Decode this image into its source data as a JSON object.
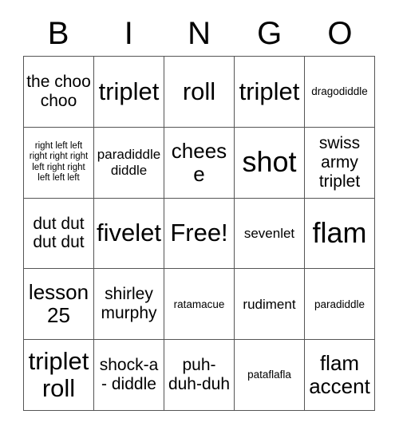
{
  "header": {
    "letters": [
      "B",
      "I",
      "N",
      "G",
      "O"
    ]
  },
  "colors": {
    "background": "#ffffff",
    "text": "#000000",
    "grid_line": "#555555"
  },
  "grid": {
    "columns": 5,
    "rows": 5,
    "free_space_label": "Free!",
    "cells": [
      {
        "text": "the choo choo",
        "size": "lg"
      },
      {
        "text": "triplet",
        "size": "xxl"
      },
      {
        "text": "roll",
        "size": "xxl"
      },
      {
        "text": "triplet",
        "size": "xxl"
      },
      {
        "text": "dragodiddle",
        "size": "sm"
      },
      {
        "text": "right left left right right right left right right left left left",
        "size": "xs"
      },
      {
        "text": "paradiddle diddle",
        "size": "md"
      },
      {
        "text": "cheese",
        "size": "xl"
      },
      {
        "text": "shot",
        "size": "huge"
      },
      {
        "text": "swiss army triplet",
        "size": "lg"
      },
      {
        "text": "dut dut dut dut",
        "size": "lg"
      },
      {
        "text": "fivelet",
        "size": "xxl"
      },
      {
        "text": "Free!",
        "size": "xxl"
      },
      {
        "text": "sevenlet",
        "size": "md"
      },
      {
        "text": "flam",
        "size": "huge"
      },
      {
        "text": "lesson 25",
        "size": "xl"
      },
      {
        "text": "shirley murphy",
        "size": "lg"
      },
      {
        "text": "ratamacue",
        "size": "sm"
      },
      {
        "text": "rudiment",
        "size": "md"
      },
      {
        "text": "paradiddle",
        "size": "sm"
      },
      {
        "text": "triplet roll",
        "size": "xxl"
      },
      {
        "text": "shock-a - diddle",
        "size": "lg"
      },
      {
        "text": "puh-duh-duh",
        "size": "lg"
      },
      {
        "text": "pataflafla",
        "size": "sm"
      },
      {
        "text": "flam accent",
        "size": "xl"
      }
    ]
  }
}
